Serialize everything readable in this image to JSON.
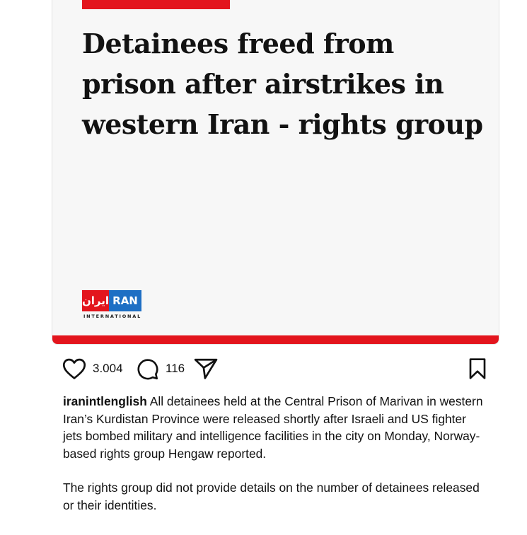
{
  "post": {
    "headline": "Detainees freed from prison after airstrikes in western Iran - rights group",
    "logo": {
      "persian_text": "ایران",
      "english_text": "RAN",
      "subtitle": "INTERNATIONAL"
    },
    "likes_count": "3.004",
    "comments_count": "116",
    "caption": {
      "username": "iranintlenglish",
      "text": "All detainees held at the Central Prison of Marivan in western Iran’s Kurdistan Province were released shortly after Israeli and US fighter jets bombed military and intelligence facilities in the city on Monday, Norway-based rights group Hengaw reported.",
      "text2": "The rights group did not provide details on the number of detainees released or their identities."
    }
  },
  "icons": {
    "like": "heart-icon",
    "comment": "comment-icon",
    "share": "send-icon",
    "save": "bookmark-icon"
  },
  "colors": {
    "brand_red": "#e3151d",
    "brand_blue": "#1e6fc4",
    "text": "#111111",
    "image_bg": "#f7f7f7"
  }
}
